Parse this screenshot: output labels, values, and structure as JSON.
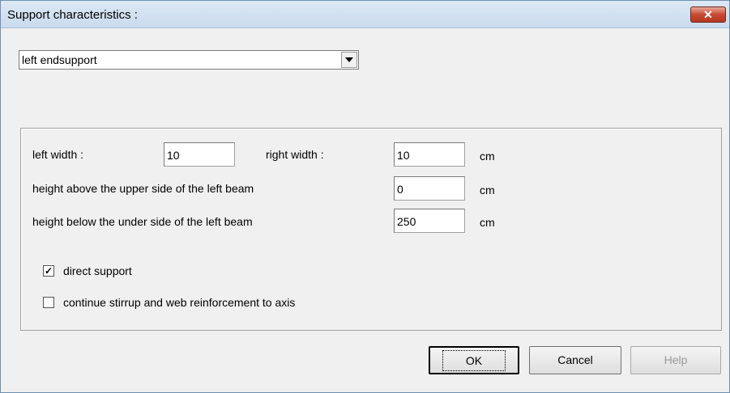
{
  "window": {
    "title": "Support characteristics :",
    "close_glyph": "✕"
  },
  "support_select": {
    "value": "left endsupport"
  },
  "dimensions": {
    "left_width": {
      "label": "left width :",
      "value": "10"
    },
    "right_width": {
      "label": "right width :",
      "value": "10",
      "unit": "cm"
    },
    "height_above": {
      "label": "height above the upper side of the left beam",
      "value": "0",
      "unit": "cm"
    },
    "height_below": {
      "label": "height below the under side of the left beam",
      "value": "250",
      "unit": "cm"
    }
  },
  "options": {
    "direct_support": {
      "label": "direct support",
      "checked": true,
      "mark": "✓"
    },
    "continue_stirrup": {
      "label": "continue stirrup and web reinforcement to axis",
      "checked": false,
      "mark": ""
    }
  },
  "buttons": {
    "ok": "OK",
    "cancel": "Cancel",
    "help": "Help"
  }
}
